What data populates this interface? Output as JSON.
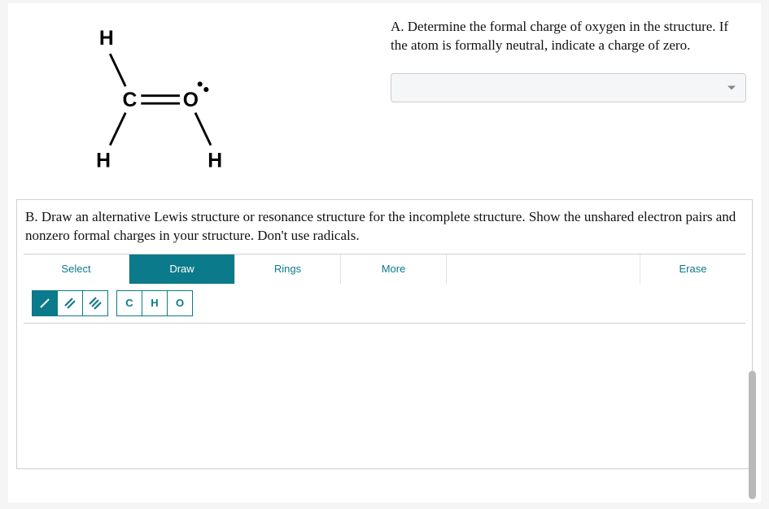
{
  "questionA": {
    "label": "A.",
    "text": "Determine the formal charge of oxygen in the structure. If the atom is formally neutral, indicate a charge of zero."
  },
  "questionB": {
    "label": "B.",
    "text": "Draw an alternative Lewis structure or resonance structure for the incomplete structure. Show the unshared electron pairs and nonzero formal charges in your structure. Don't use radicals."
  },
  "structure": {
    "atoms": {
      "h_top": "H",
      "c_center": "C",
      "o_right": "O",
      "h_bottom_left": "H",
      "h_bottom_right": "H"
    }
  },
  "toolbar": {
    "tabs": {
      "select": "Select",
      "draw": "Draw",
      "rings": "Rings",
      "more": "More",
      "erase": "Erase"
    },
    "atoms": {
      "c": "C",
      "h": "H",
      "o": "O"
    }
  },
  "answer_select": {
    "value": ""
  }
}
